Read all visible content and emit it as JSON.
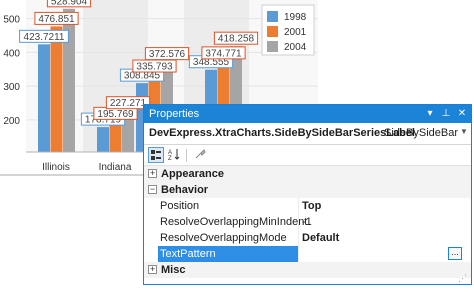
{
  "chart_data": {
    "type": "bar",
    "categories": [
      "Illinois",
      "Indiana",
      "",
      ""
    ],
    "series": [
      {
        "name": "1998",
        "values": [
          423.7211,
          178.719,
          308.845,
          348.555
        ],
        "color": "#5b9bd5"
      },
      {
        "name": "2001",
        "values": [
          476.851,
          195.769,
          335.793,
          374.771
        ],
        "color": "#ed7d31"
      },
      {
        "name": "2004",
        "values": [
          528.904,
          227.271,
          372.576,
          418.258
        ],
        "color": "#a5a5a5"
      }
    ],
    "ytick_labels": [
      "200",
      "300",
      "400",
      "500"
    ],
    "ylim": [
      105,
      555
    ],
    "legend": "top-right",
    "data_labels": {
      "series_0": [
        "423.7211",
        "178.719",
        "308.845",
        "348.555"
      ],
      "series_1": [
        "476.851",
        "195.769",
        "335.793",
        "374.771"
      ],
      "series_2": [
        "528.904",
        "227.271",
        "372.576",
        "418.258"
      ]
    }
  },
  "properties_panel": {
    "title": "Properties",
    "object_name": "DevExpress.XtraCharts.SideBySideBarSeriesLabel",
    "object_type": "SideBySideBarS",
    "categories": [
      {
        "label": "Appearance",
        "expander": "+"
      },
      {
        "label": "Behavior",
        "expander": "−"
      },
      {
        "label": "Misc",
        "expander": "+"
      }
    ],
    "rows": [
      {
        "label": "Position",
        "value": "Top",
        "bold": true
      },
      {
        "label": "ResolveOverlappingMinIndent",
        "value": "-1",
        "bold": false
      },
      {
        "label": "ResolveOverlappingMode",
        "value": "Default",
        "bold": true
      },
      {
        "label": "TextPattern",
        "value": "",
        "bold": false
      }
    ],
    "ellipsis": "...",
    "toolbar_icons": [
      "categorized-icon",
      "alphabetical-icon",
      "property-pages-icon"
    ]
  }
}
